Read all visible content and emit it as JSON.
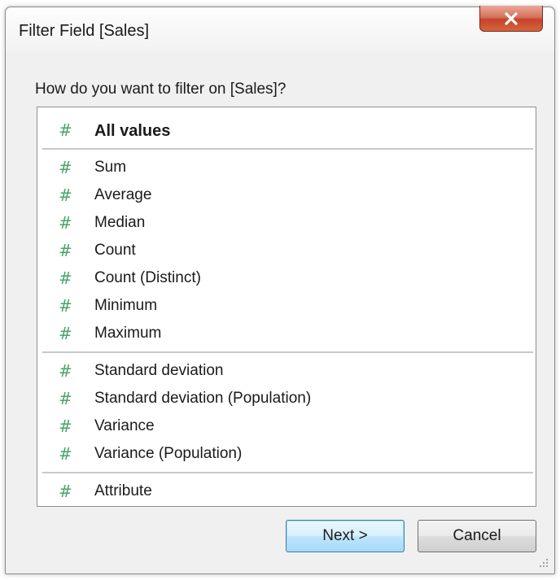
{
  "window": {
    "title": "Filter Field [Sales]",
    "close_icon": "close-icon"
  },
  "prompt": "How do you want to filter on [Sales]?",
  "list": {
    "icon": "#",
    "items": [
      {
        "label": "All values",
        "bold": true
      },
      {
        "label": "Sum"
      },
      {
        "label": "Average"
      },
      {
        "label": "Median"
      },
      {
        "label": "Count"
      },
      {
        "label": "Count (Distinct)"
      },
      {
        "label": "Minimum"
      },
      {
        "label": "Maximum"
      },
      {
        "label": "Standard deviation"
      },
      {
        "label": "Standard deviation (Population)"
      },
      {
        "label": "Variance"
      },
      {
        "label": "Variance (Population)"
      },
      {
        "label": "Attribute"
      }
    ]
  },
  "buttons": {
    "next_label": "Next >",
    "cancel_label": "Cancel"
  },
  "colors": {
    "hash_icon": "#4aa46a",
    "close_button": "#c5432a",
    "default_button_border": "#3c7fb1"
  }
}
